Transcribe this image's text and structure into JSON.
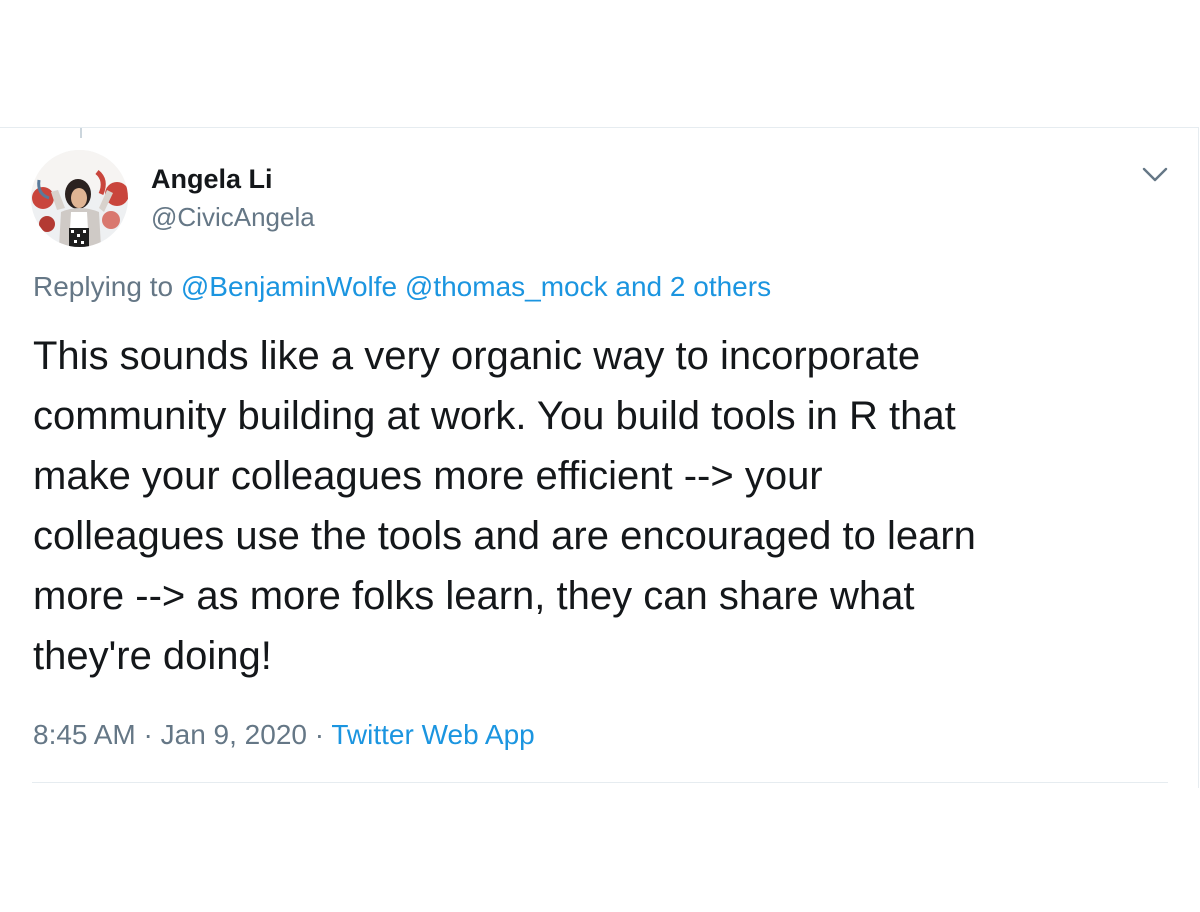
{
  "tweet": {
    "author": {
      "name": "Angela Li",
      "handle": "@CivicAngela"
    },
    "replying_prefix": "Replying to",
    "replying_to": [
      {
        "handle": "@BenjaminWolfe"
      },
      {
        "handle": "@thomas_mock"
      }
    ],
    "replying_and": "and",
    "replying_others": "2 others",
    "text": "This sounds like a very organic way to incorporate\ncommunity building at work. You build tools in R that\nmake your colleagues more efficient --> your\ncolleagues use the tools and are  encouraged to learn\nmore --> as more folks learn, they can share what\nthey're doing!",
    "time": "8:45 AM",
    "separator": "·",
    "date": "Jan 9, 2020",
    "source": "Twitter Web App"
  },
  "colors": {
    "link": "#1b95e0",
    "muted": "#657786",
    "text": "#14171a",
    "border": "#e6ecf0"
  },
  "icons": {
    "menu": "chevron-down-icon"
  }
}
